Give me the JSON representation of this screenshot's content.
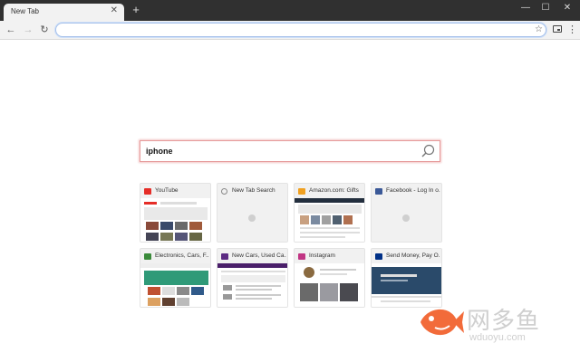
{
  "browser": {
    "tab_title": "New Tab",
    "tab_close_icon": "close-icon",
    "new_tab_icon": "plus-icon",
    "window_controls": [
      "minimize-icon",
      "maximize-icon",
      "close-icon"
    ]
  },
  "toolbar": {
    "back_icon": "back-arrow-icon",
    "forward_icon": "forward-arrow-icon",
    "reload_icon": "reload-icon",
    "address_value": "",
    "bookmark_icon": "star-icon",
    "extension_icon": "extension-icon",
    "menu_icon": "kebab-menu-icon"
  },
  "search": {
    "value": "iphone",
    "icon": "magnifier-icon"
  },
  "tiles": [
    {
      "title": "YouTube",
      "favicon_color": "#e52d27"
    },
    {
      "title": "New Tab Search",
      "favicon_color": "#888888"
    },
    {
      "title": "Amazon.com: Gifts",
      "favicon_color": "#f0a020"
    },
    {
      "title": "Facebook - Log In o...",
      "favicon_color": "#3b5998"
    },
    {
      "title": "Electronics, Cars, F...",
      "favicon_color": "#3a8a3a"
    },
    {
      "title": "New Cars, Used Ca...",
      "favicon_color": "#5b2a82"
    },
    {
      "title": "Instagram",
      "favicon_color": "#c13584"
    },
    {
      "title": "Send Money, Pay O...",
      "favicon_color": "#003087"
    }
  ],
  "watermark": {
    "title": "网多鱼",
    "url": "wduoyu.com",
    "accent": "#f26b3a"
  }
}
